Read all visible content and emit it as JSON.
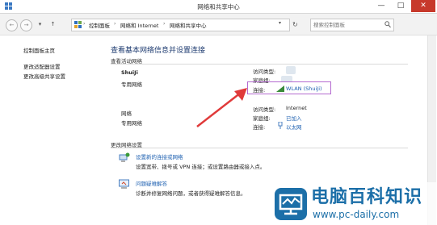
{
  "window": {
    "title": "网络和共享中心",
    "minimize": "—",
    "maximize": "□",
    "close": "✕"
  },
  "address": {
    "back": "←",
    "forward": "→",
    "up": "↑",
    "crumbs": [
      "控制面板",
      "网络和 Internet",
      "网络和共享中心"
    ],
    "search_placeholder": "搜索控制面板",
    "refresh": "↻"
  },
  "sidebar": {
    "items": [
      {
        "label": "控制面板主页"
      },
      {
        "label": "更改适配器设置"
      },
      {
        "label": "更改高级共享设置"
      }
    ]
  },
  "main": {
    "heading": "查看基本网络信息并设置连接",
    "active_section": "查看活动网络",
    "networks": [
      {
        "name": "ShuiJi",
        "type": "专用网络",
        "access_label": "访问类型:",
        "access_value": "",
        "homegroup_label": "家庭组:",
        "homegroup_value": "",
        "connection_label": "连接:",
        "connection_value": "WLAN (ShuiJi)"
      },
      {
        "name": "网络",
        "type": "专用网络",
        "access_label": "访问类型:",
        "access_value": "Internet",
        "homegroup_label": "家庭组:",
        "homegroup_value": "已加入",
        "connection_label": "连接:",
        "connection_value": "以太网"
      }
    ],
    "change_section": "更改网络设置",
    "tasks": [
      {
        "title": "设置新的连接或网络",
        "desc": "设置宽带、拨号或 VPN 连接；或设置路由器或接入点。"
      },
      {
        "title": "问题疑难解答",
        "desc": "诊断并修复网络问题，或者获得疑难解答信息。"
      }
    ]
  },
  "watermark": {
    "brand": "电脑百科知识",
    "url": "www.pc-daily.com"
  },
  "colors": {
    "link": "#1c5fb0",
    "heading": "#1e3b70",
    "arrow": "#e03a3a",
    "highlight": "#b46ad0",
    "close": "#c7392b"
  }
}
